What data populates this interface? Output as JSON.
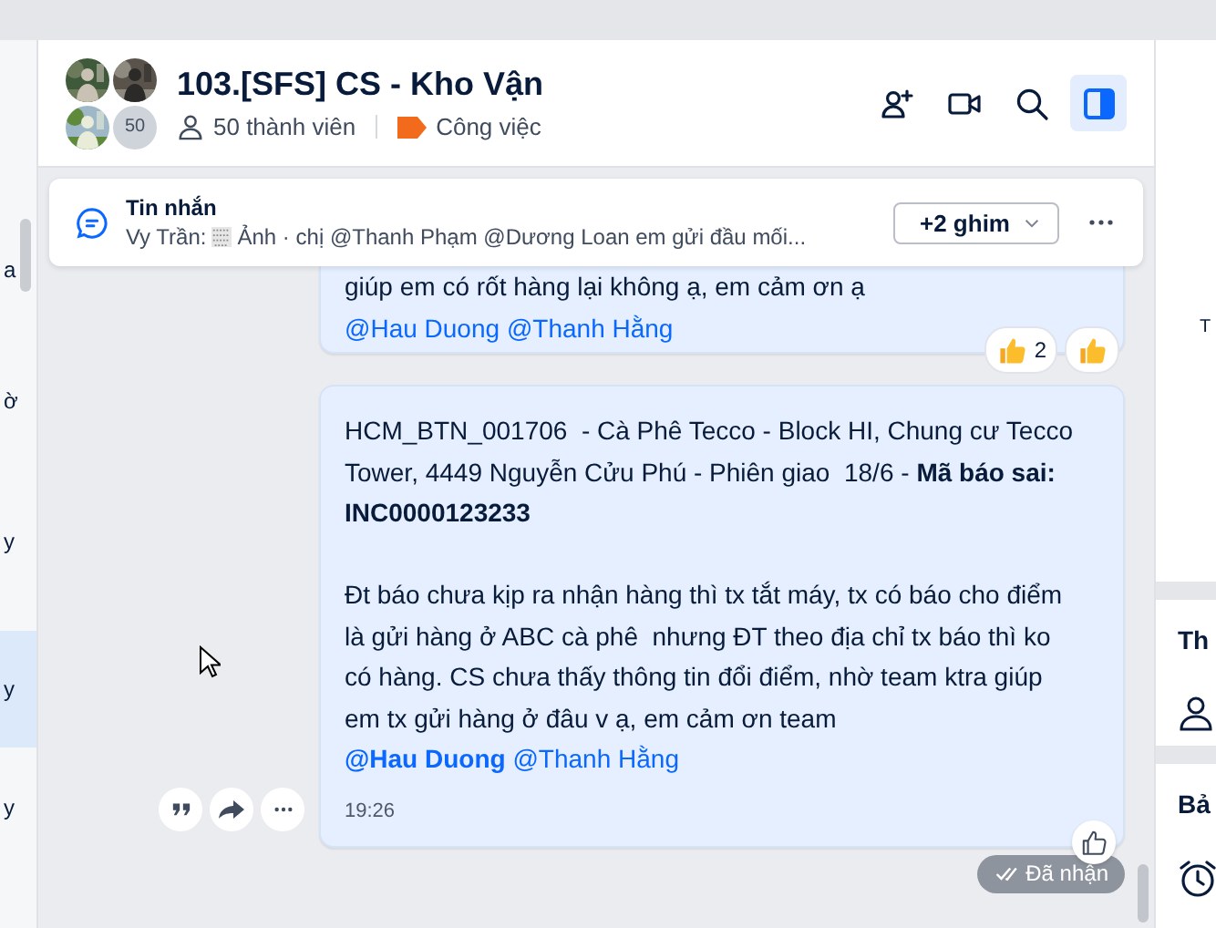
{
  "sidebar": {
    "items": [
      {
        "text": "a",
        "selected": false
      },
      {
        "text": "ờ",
        "selected": false
      },
      {
        "text": "y",
        "selected": false
      },
      {
        "text": "y",
        "selected": true
      },
      {
        "text": "y",
        "selected": false
      }
    ]
  },
  "header": {
    "title": "103.[SFS] CS - Kho Vận",
    "avatars": [
      {
        "kind": "picture"
      },
      {
        "kind": "picture"
      },
      {
        "kind": "picture"
      },
      {
        "kind": "count",
        "text": "50"
      }
    ],
    "members": "50 thành viên",
    "tag": "Công việc",
    "actions": [
      {
        "kind": "add-member",
        "selected": false
      },
      {
        "kind": "video",
        "selected": false
      },
      {
        "kind": "search",
        "selected": false
      },
      {
        "kind": "panel",
        "selected": true
      }
    ]
  },
  "pinned": {
    "title": "Tin nhắn",
    "sender": "Vy Trần:",
    "preview": "Ảnh · chị @Thanh Phạm @Dương Loan em gửi đầu mối...",
    "button": "+2 ghim"
  },
  "messages": [
    {
      "paragraphs": [
        [
          {
            "kind": "text",
            "text": "giúp em có rốt hàng lại không ạ, em cảm ơn ạ "
          },
          {
            "kind": "mention",
            "text": "@Hau Duong"
          },
          {
            "kind": "mention",
            "text": "@Thanh Hằng"
          }
        ]
      ],
      "reactions": [
        {
          "kind": "counted",
          "count": "2"
        },
        {
          "kind": "single"
        }
      ]
    },
    {
      "paragraphs": [
        [
          {
            "kind": "text",
            "text": "HCM_BTN_001706  - Cà Phê Tecco - Block HI, Chung cư Tecco Tower, 4449 Nguyễn Cửu Phú - Phiên giao  18/6 - **Mã báo sai: INC0000123233**"
          }
        ],
        [
          {
            "kind": "text",
            "text": "Đt báo chưa kịp ra nhận hàng thì tx tắt máy, tx có báo cho điểm là gửi hàng ở ABC cà phê  nhưng ĐT theo địa chỉ tx báo thì ko có hàng. CS chưa thấy thông tin đổi điểm, nhờ team ktra giúp em tx gửi hàng ở đâu v ạ, em cảm ơn team "
          },
          {
            "kind": "mention",
            "text": "**@Hau Duong**"
          },
          {
            "kind": "mention",
            "text": "@Thanh Hằng"
          }
        ]
      ],
      "time": "19:26",
      "hover_actions": [
        {
          "kind": "quote"
        },
        {
          "kind": "forward"
        },
        {
          "kind": "more"
        }
      ],
      "like_button": true,
      "status": "Đã nhận"
    }
  ],
  "right_panel": {
    "sections": [
      {
        "kind": "caption",
        "text": "T"
      },
      {
        "kind": "members",
        "text": "Th"
      },
      {
        "kind": "reminders",
        "text": "Bả"
      }
    ]
  }
}
